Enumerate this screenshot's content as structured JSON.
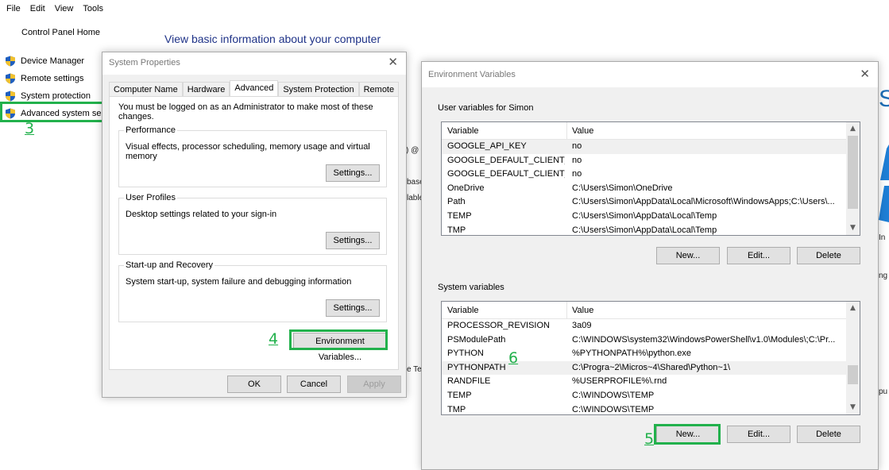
{
  "menu": [
    "File",
    "Edit",
    "View",
    "Tools"
  ],
  "control_panel": {
    "home": "Control Panel Home",
    "title": "View basic information about your computer",
    "nav": [
      {
        "label": "Device Manager",
        "icon": "shield-icon"
      },
      {
        "label": "Remote settings",
        "icon": "shield-icon"
      },
      {
        "label": "System protection",
        "icon": "shield-icon"
      },
      {
        "label": "Advanced system se",
        "icon": "shield-icon"
      }
    ],
    "partial_text": [
      ") @",
      "base",
      "lable",
      "e Te",
      "S",
      "In",
      "ng",
      "pu"
    ]
  },
  "steps": {
    "s3": "3",
    "s4": "4",
    "s5": "5",
    "s6": "6"
  },
  "system_properties": {
    "title": "System Properties",
    "close": "✕",
    "tabs": [
      "Computer Name",
      "Hardware",
      "Advanced",
      "System Protection",
      "Remote"
    ],
    "active_tab": "Advanced",
    "admin_note": "You must be logged on as an Administrator to make most of these changes.",
    "groups": [
      {
        "title": "Performance",
        "desc": "Visual effects, processor scheduling, memory usage and virtual memory",
        "button": "Settings..."
      },
      {
        "title": "User Profiles",
        "desc": "Desktop settings related to your sign-in",
        "button": "Settings..."
      },
      {
        "title": "Start-up and Recovery",
        "desc": "System start-up, system failure and debugging information",
        "button": "Settings..."
      }
    ],
    "env_button": "Environment Variables...",
    "ok": "OK",
    "cancel": "Cancel",
    "apply": "Apply"
  },
  "environment_variables": {
    "title": "Environment Variables",
    "close": "✕",
    "user_section": "User variables for Simon",
    "system_section": "System variables",
    "columns": [
      "Variable",
      "Value"
    ],
    "user_vars": [
      {
        "name": "GOOGLE_API_KEY",
        "value": "no"
      },
      {
        "name": "GOOGLE_DEFAULT_CLIENT_ID",
        "value": "no"
      },
      {
        "name": "GOOGLE_DEFAULT_CLIENT_...",
        "value": "no"
      },
      {
        "name": "OneDrive",
        "value": "C:\\Users\\Simon\\OneDrive"
      },
      {
        "name": "Path",
        "value": "C:\\Users\\Simon\\AppData\\Local\\Microsoft\\WindowsApps;C:\\Users\\..."
      },
      {
        "name": "TEMP",
        "value": "C:\\Users\\Simon\\AppData\\Local\\Temp"
      },
      {
        "name": "TMP",
        "value": "C:\\Users\\Simon\\AppData\\Local\\Temp"
      }
    ],
    "system_vars": [
      {
        "name": "PROCESSOR_REVISION",
        "value": "3a09"
      },
      {
        "name": "PSModulePath",
        "value": "C:\\WINDOWS\\system32\\WindowsPowerShell\\v1.0\\Modules\\;C:\\Pr..."
      },
      {
        "name": "PYTHON",
        "value": "%PYTHONPATH%\\python.exe"
      },
      {
        "name": "PYTHONPATH",
        "value": "C:\\Progra~2\\Micros~4\\Shared\\Python~1\\"
      },
      {
        "name": "RANDFILE",
        "value": "%USERPROFILE%\\.rnd"
      },
      {
        "name": "TEMP",
        "value": "C:\\WINDOWS\\TEMP"
      },
      {
        "name": "TMP",
        "value": "C:\\WINDOWS\\TEMP"
      }
    ],
    "selected_user_row": "GOOGLE_API_KEY",
    "selected_system_row": "PYTHONPATH",
    "new": "New...",
    "edit": "Edit...",
    "delete": "Delete"
  },
  "colors": {
    "highlight": "#22b14c",
    "title_blue": "#1e3287"
  }
}
